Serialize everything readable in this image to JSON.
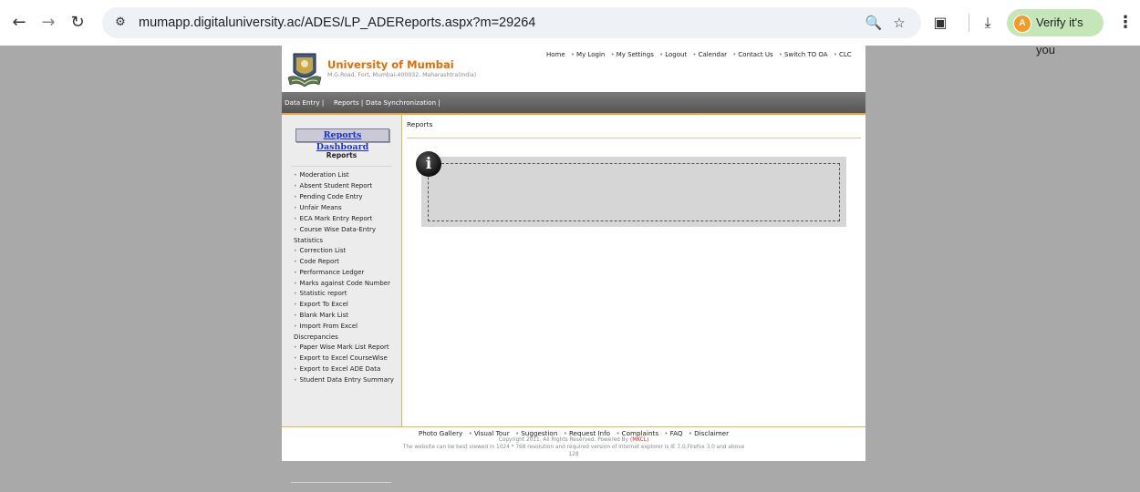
{
  "browser": {
    "url": "mumapp.digitaluniversity.ac/ADES/LP_ADEReports.aspx?m=29264",
    "verify_label": "Verify it's you",
    "avatar_letter": "A",
    "icons": [
      "back-arrow",
      "forward-arrow",
      "reload",
      "site-info",
      "zoom",
      "bookmark-star",
      "extensions",
      "download",
      "menu-kebab"
    ]
  },
  "header": {
    "university_name": "University of Mumbai",
    "address": "M.G.Road, Fort, Mumbai-400032, Maharashtra(India)",
    "top_links": [
      "Home",
      "My Login",
      "My Settings",
      "Logout",
      "Calendar",
      "Contact Us",
      "Switch TO OA",
      "CLC"
    ]
  },
  "menubar": {
    "items": [
      "Data Entry |",
      "Reports |",
      "Data Synchronization |"
    ]
  },
  "sidebar": {
    "dashboard_button": "Reports Dashboard",
    "title": "Reports",
    "items": [
      "Moderation List",
      "Absent Student Report",
      "Pending Code Entry",
      "Unfair Means",
      "ECA Mark Entry Report",
      "Course Wise Data-Entry Statistics",
      "Correction List",
      "Code Report",
      "Performance Ledger",
      "Marks against Code Number",
      "Statistic report",
      "Export To Excel",
      "Blank Mark List",
      "Import From Excel Discrepancies",
      "Paper Wise Mark List Report",
      "Export to Excel CourseWise",
      "Export to Excel ADE Data",
      "Student Data Entry Summary"
    ]
  },
  "content": {
    "breadcrumb": "Reports",
    "info_icon_glyph": "i"
  },
  "footer": {
    "links": [
      "Photo Gallery",
      "Visual Tour",
      "Suggestion",
      "Request Info",
      "Complaints",
      "FAQ",
      "Disclaimer"
    ],
    "copyright": "Copyright 2011. All Rights Reserved. Powered By",
    "powered_by": "(MKCL)",
    "best_viewed": "The website can be best viewed in 1024 * 768 resolution and required version of internet explorer is IE 7.0,Firefox 3.0 and above",
    "counter": "128"
  },
  "colors": {
    "page_bg": "#a9a9a9",
    "brand_orange": "#e06d00",
    "dashboard_link": "#1b2fd6",
    "verify_bg": "#c5e6b8"
  }
}
